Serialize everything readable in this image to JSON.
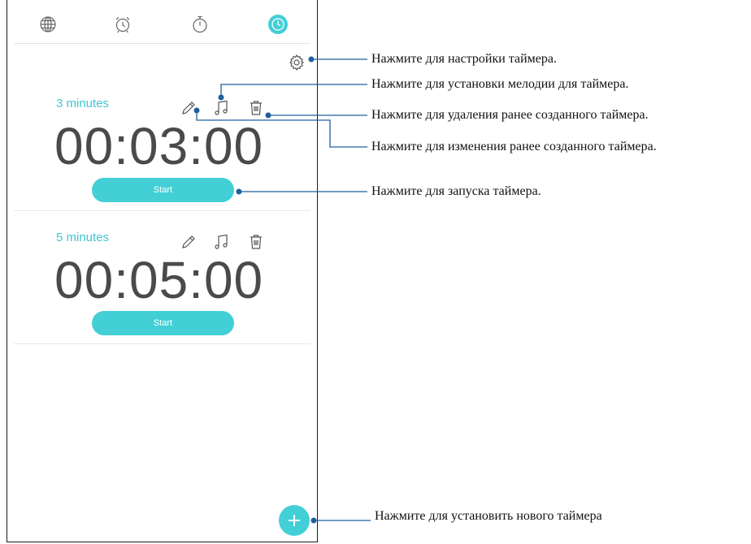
{
  "app": {
    "tabs": [
      {
        "icon": "globe-icon",
        "label": "world clock"
      },
      {
        "icon": "alarm-clock-icon",
        "label": "alarm"
      },
      {
        "icon": "stopwatch-icon",
        "label": "stopwatch"
      },
      {
        "icon": "timer-icon",
        "label": "timer",
        "active": true
      }
    ],
    "accent_color": "#43cfd6",
    "timers": [
      {
        "name": "3 minutes",
        "time": "00:03:00",
        "start_label": "Start"
      },
      {
        "name": "5 minutes",
        "time": "00:05:00",
        "start_label": "Start"
      }
    ]
  },
  "callouts": {
    "settings": "Нажмите для настройки таймера.",
    "ringtone": "Нажмите для установки мелодии для таймера.",
    "delete": "Нажмите для удаления ранее созданного таймера.",
    "edit": "Нажмите для изменения ранее созданного таймера.",
    "start": "Нажмите для запуска таймера.",
    "add": "Нажмите для установить нового таймера"
  }
}
